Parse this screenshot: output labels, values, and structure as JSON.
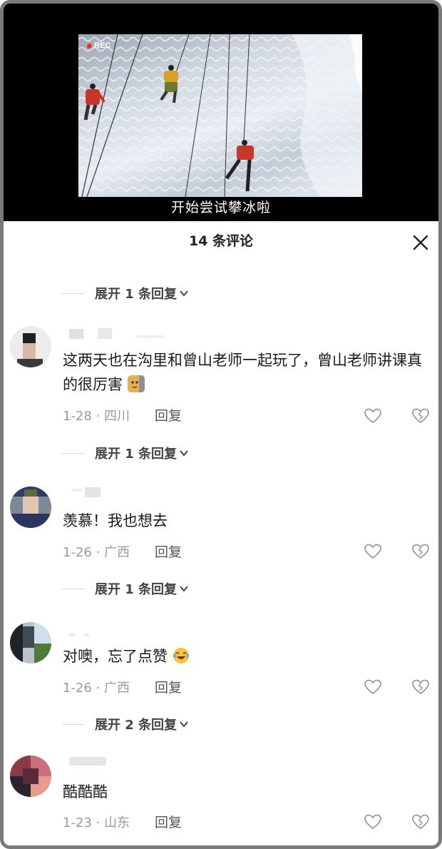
{
  "video": {
    "rec_label": "REC",
    "subtitle": "开始尝试攀冰啦"
  },
  "panel": {
    "title": "14 条评论",
    "close_icon": "close-icon"
  },
  "comments": [
    {
      "expand_label": "展开 1 条回复",
      "text": "这两天也在沟里和曾山老师一起玩了，曾山老师讲课真的很厉害",
      "emoji": "cat-emoji",
      "date_location": "1-28 · 四川",
      "reply_label": "回复"
    },
    {
      "expand_label": "展开 1 条回复",
      "text": "羡慕！我也想去",
      "date_location": "1-26 · 广西",
      "reply_label": "回复"
    },
    {
      "expand_label": "展开 1 条回复",
      "text": "对噢，忘了点赞",
      "emoji": "laugh-cry-emoji",
      "date_location": "1-26 · 广西",
      "reply_label": "回复"
    },
    {
      "expand_label": "展开 2 条回复",
      "text": "酷酷酷",
      "date_location": "1-23 · 山东",
      "reply_label": "回复"
    }
  ],
  "colors": {
    "text_primary": "#1a1a1a",
    "text_secondary": "#9a9a9a",
    "background": "#ffffff",
    "video_background": "#000000"
  }
}
